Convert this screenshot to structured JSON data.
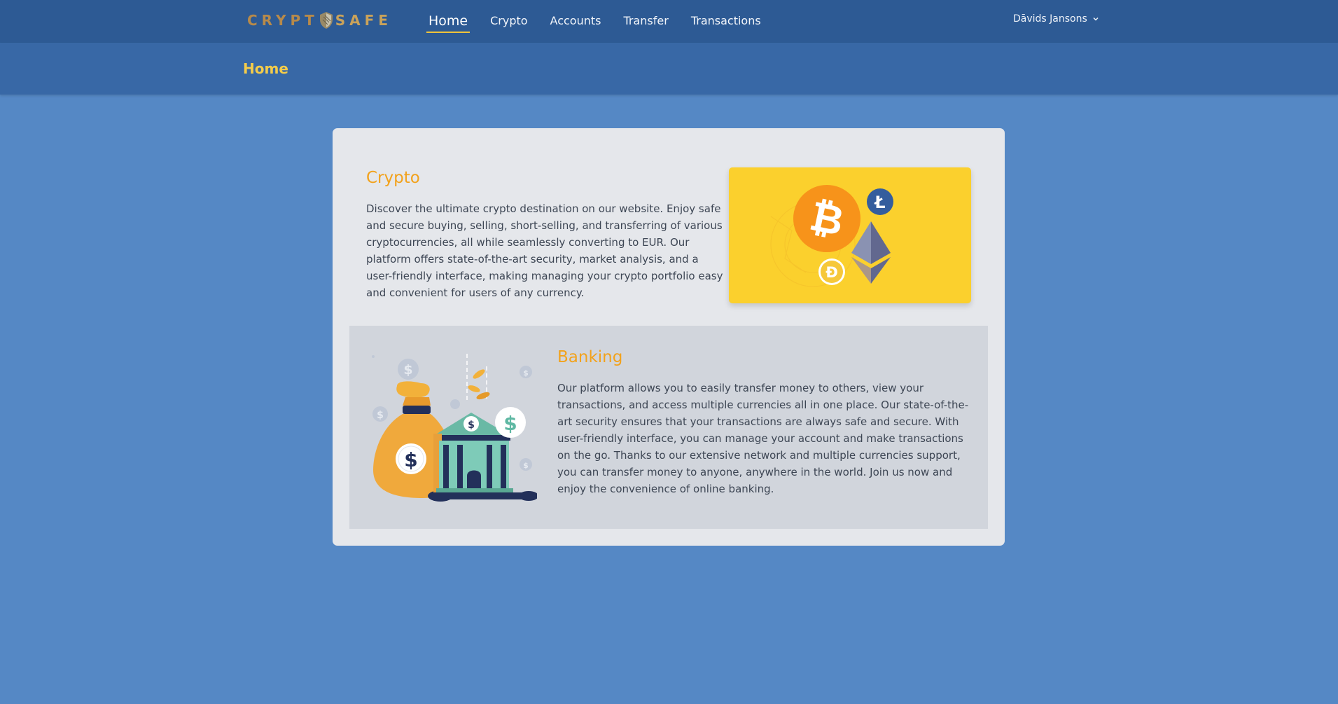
{
  "brand": {
    "logo_text_left": "CRYPT",
    "logo_text_right": "SAFE"
  },
  "nav": {
    "items": [
      {
        "label": "Home",
        "active": true
      },
      {
        "label": "Crypto",
        "active": false
      },
      {
        "label": "Accounts",
        "active": false
      },
      {
        "label": "Transfer",
        "active": false
      },
      {
        "label": "Transactions",
        "active": false
      }
    ],
    "user_name": "Dāvids Jansons"
  },
  "page": {
    "title": "Home"
  },
  "crypto": {
    "title": "Crypto",
    "text": "Discover the ultimate crypto destination on our website. Enjoy safe and secure buying, selling, short-selling, and transferring of various cryptocurrencies, all while seamlessly converting to EUR. Our platform offers state-of-the-art security, market analysis, and a user-friendly interface, making managing your crypto portfolio easy and convenient for users of any currency.",
    "image_icons": [
      "bitcoin-icon",
      "litecoin-icon",
      "ethereum-icon",
      "dogecoin-icon"
    ]
  },
  "banking": {
    "title": "Banking",
    "text": "Our platform allows you to easily transfer money to others, view your transactions, and access multiple currencies all in one place. Our state-of-the-art security ensures that your transactions are always safe and secure. With user-friendly interface, you can manage your account and make transactions on the go. Thanks to our extensive network and multiple currencies support, you can transfer money to anyone, anywhere in the world. Join us now and enjoy the convenience of online banking.",
    "image_icons": [
      "money-bag-icon",
      "bank-building-icon",
      "dollar-coin-icon"
    ]
  },
  "colors": {
    "background": "#5588c5",
    "nav_bg": "#2d5a94",
    "subheader_bg": "#3868a6",
    "accent_yellow": "#f4cc4a",
    "section_title": "#f2a21c",
    "card_bg": "#e5e7eb",
    "banking_bg": "#d1d5dc"
  }
}
